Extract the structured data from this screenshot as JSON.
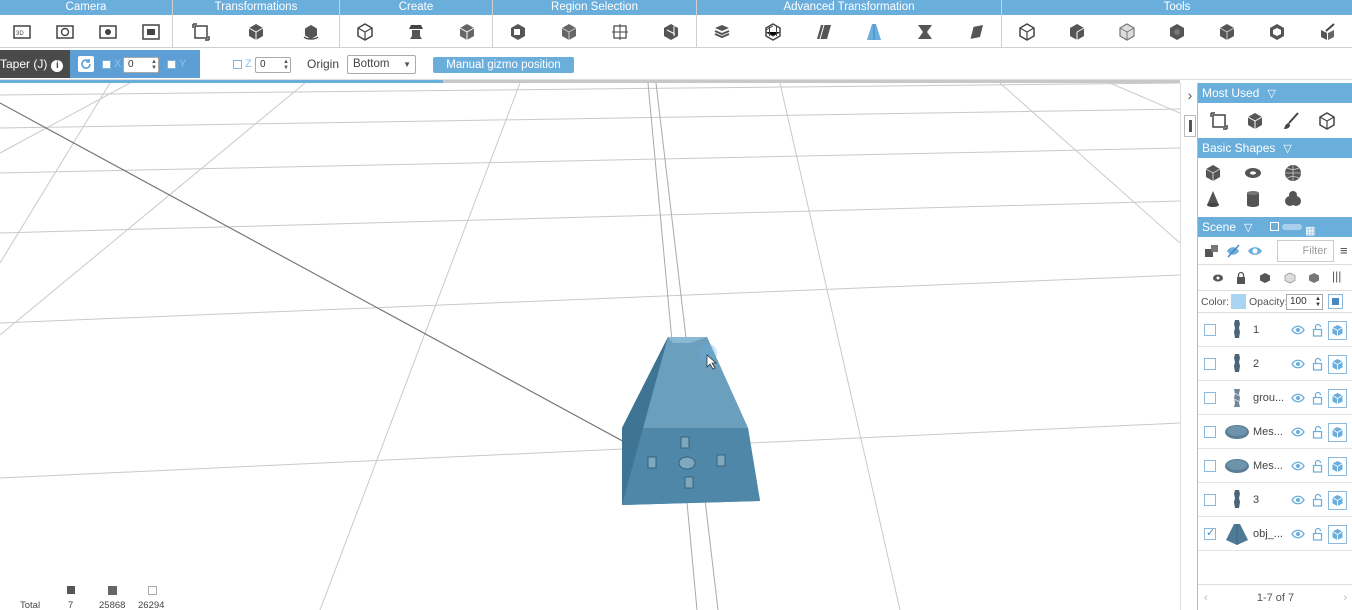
{
  "ribbon": {
    "groups": [
      {
        "label": "Camera",
        "icons": [
          "camera-reset-icon",
          "camera-rotate-icon",
          "camera-screenshot-icon",
          "camera-frame-icon"
        ]
      },
      {
        "label": "Transformations",
        "icons": [
          "transform-icon",
          "scale-icon",
          "rotate-object-icon"
        ]
      },
      {
        "label": "Create",
        "icons": [
          "create-box-icon",
          "create-extrude-icon",
          "create-cube-icon"
        ]
      },
      {
        "label": "Region Selection",
        "icons": [
          "region-select-icon",
          "region-cube-icon",
          "region-bbox-icon",
          "region-grid-icon"
        ]
      },
      {
        "label": "Advanced Transformation",
        "icons": [
          "stack-icon",
          "lattice-icon",
          "shear-icon",
          "taper-icon",
          "twist-icon",
          "bend-icon"
        ]
      },
      {
        "label": "Tools",
        "icons": [
          "tool-box-icon",
          "tool-solid-icon",
          "tool-wire-icon",
          "tool-sphere-icon",
          "tool-cube-icon",
          "tool-hollow-icon",
          "tool-repair-icon"
        ]
      }
    ]
  },
  "options": {
    "tool_label": "Taper (J)",
    "info": "i",
    "x_label": "X",
    "x_value": "0",
    "y_label": "Y",
    "z_label": "Z",
    "z_value": "0",
    "origin_label": "Origin",
    "origin_value": "Bottom",
    "manual_label": "Manual gizmo position",
    "progress": 0.375
  },
  "stats": {
    "label": "Total",
    "objects": "7",
    "vertices": "25868",
    "faces": "26294"
  },
  "panel": {
    "most_used": "Most Used",
    "basic_shapes": "Basic Shapes",
    "scene": "Scene",
    "filter_placeholder": "Filter",
    "color_label": "Color:",
    "opacity_label": "Opacity:",
    "opacity_value": "100",
    "items": [
      {
        "name": "1",
        "checked": false,
        "thumb": "tall"
      },
      {
        "name": "2",
        "checked": false,
        "thumb": "tall"
      },
      {
        "name": "grou...",
        "checked": false,
        "thumb": "twist"
      },
      {
        "name": "Mes...",
        "checked": false,
        "thumb": "disc"
      },
      {
        "name": "Mes...",
        "checked": false,
        "thumb": "disc"
      },
      {
        "name": "3",
        "checked": false,
        "thumb": "tall"
      },
      {
        "name": "obj_...",
        "checked": true,
        "thumb": "pyramid"
      }
    ],
    "pager": "1-7 of 7"
  },
  "colors": {
    "accent": "#6aaedc",
    "object": "#4e87a8",
    "dark": "#4a4a4a"
  }
}
